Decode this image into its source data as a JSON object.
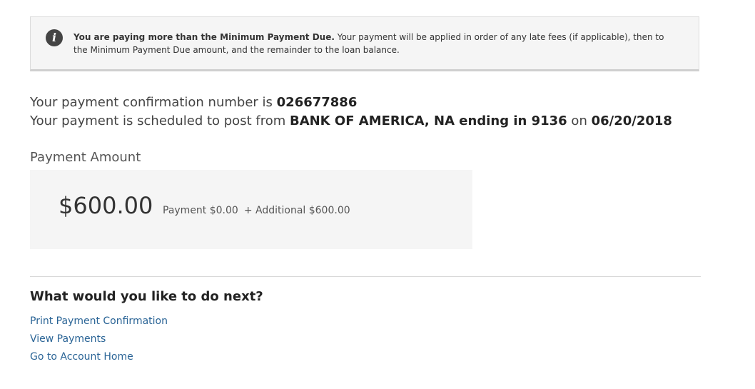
{
  "notice": {
    "icon": "info-icon",
    "icon_glyph": "i",
    "bold_text": "You are paying more than the Minimum Payment Due.",
    "body_text": " Your payment will be applied in order of any late fees (if applicable), then to the Minimum Payment Due amount, and the remainder to the loan balance."
  },
  "confirmation": {
    "line1_prefix": "Your payment confirmation number is ",
    "number": "026677886",
    "line2_prefix": "Your payment is scheduled to post from ",
    "bank": "BANK OF AMERICA, NA ending in 9136",
    "line2_mid": " on ",
    "date": "06/20/2018"
  },
  "payment": {
    "label": "Payment Amount",
    "total": "$600.00",
    "regular": "Payment $0.00",
    "additional": "+ Additional $600.00"
  },
  "next_steps": {
    "heading": "What would you like to do next?",
    "links": [
      "Print Payment Confirmation",
      "View Payments",
      "Go to Account Home"
    ]
  },
  "colors": {
    "link": "#2a6496",
    "panel_bg": "#f5f5f5",
    "icon_bg": "#444444"
  }
}
